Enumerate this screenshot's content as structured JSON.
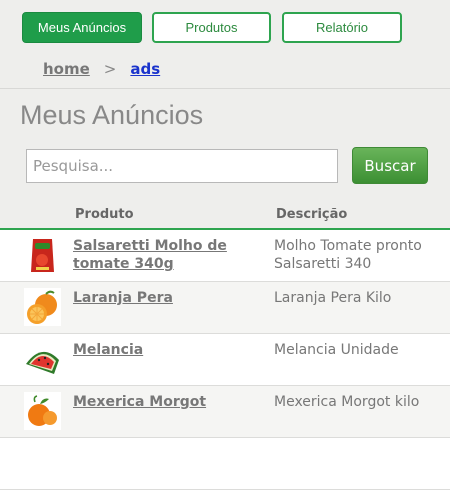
{
  "nav": {
    "tabs": [
      {
        "label": "Meus Anúncios"
      },
      {
        "label": "Produtos"
      },
      {
        "label": "Relatório"
      }
    ]
  },
  "breadcrumb": {
    "home": "home",
    "separator": ">",
    "current": "ads"
  },
  "page": {
    "title": "Meus Anúncios"
  },
  "search": {
    "placeholder": "Pesquisa...",
    "value": "",
    "button_label": "Buscar"
  },
  "table": {
    "columns": [
      "Produto",
      "Descrição"
    ],
    "rows": [
      {
        "name": "Salsaretti Molho de tomate 340g",
        "description": "Molho Tomate pronto Salsaretti 340",
        "icon": "tomato-sauce-pouch-icon"
      },
      {
        "name": "Laranja Pera",
        "description": "Laranja Pera Kilo",
        "icon": "orange-icon"
      },
      {
        "name": "Melancia",
        "description": "Melancia Unidade",
        "icon": "watermelon-icon"
      },
      {
        "name": "Mexerica Morgot",
        "description": "Mexerica Morgot kilo",
        "icon": "tangerine-icon"
      }
    ]
  },
  "colors": {
    "accent": "#2ea44f",
    "button": "#4c9b3f",
    "link": "#1a33cc"
  }
}
